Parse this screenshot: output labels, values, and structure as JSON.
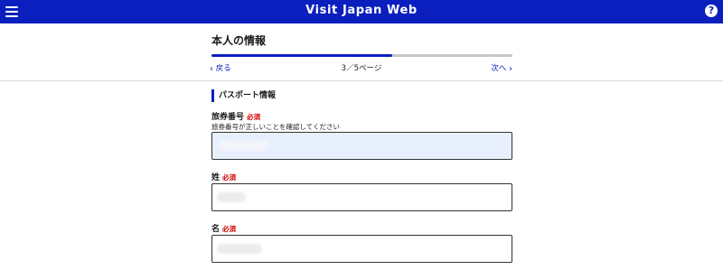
{
  "header": {
    "app_title": "Visit Japan Web",
    "help_label": "?"
  },
  "page": {
    "title": "本人の情報",
    "progress_fraction": 0.6,
    "prev_label": "戻る",
    "next_label": "次へ",
    "page_indicator": "3／5ページ"
  },
  "section": {
    "title": "パスポート情報"
  },
  "fields": [
    {
      "label": "旅券番号",
      "required": "必須",
      "hint": "旅券番号が正しいことを確認してください",
      "value_hidden": true
    },
    {
      "label": "姓",
      "required": "必須",
      "value_hidden": true
    },
    {
      "label": "名",
      "required": "必須",
      "value_hidden": true
    }
  ],
  "colors": {
    "brand": "#0b1fbf",
    "required": "#d40000",
    "filled_input_bg": "#e8f0fe"
  },
  "icons": [
    "menu-icon",
    "help-icon",
    "chevron-left-icon",
    "chevron-right-icon"
  ]
}
